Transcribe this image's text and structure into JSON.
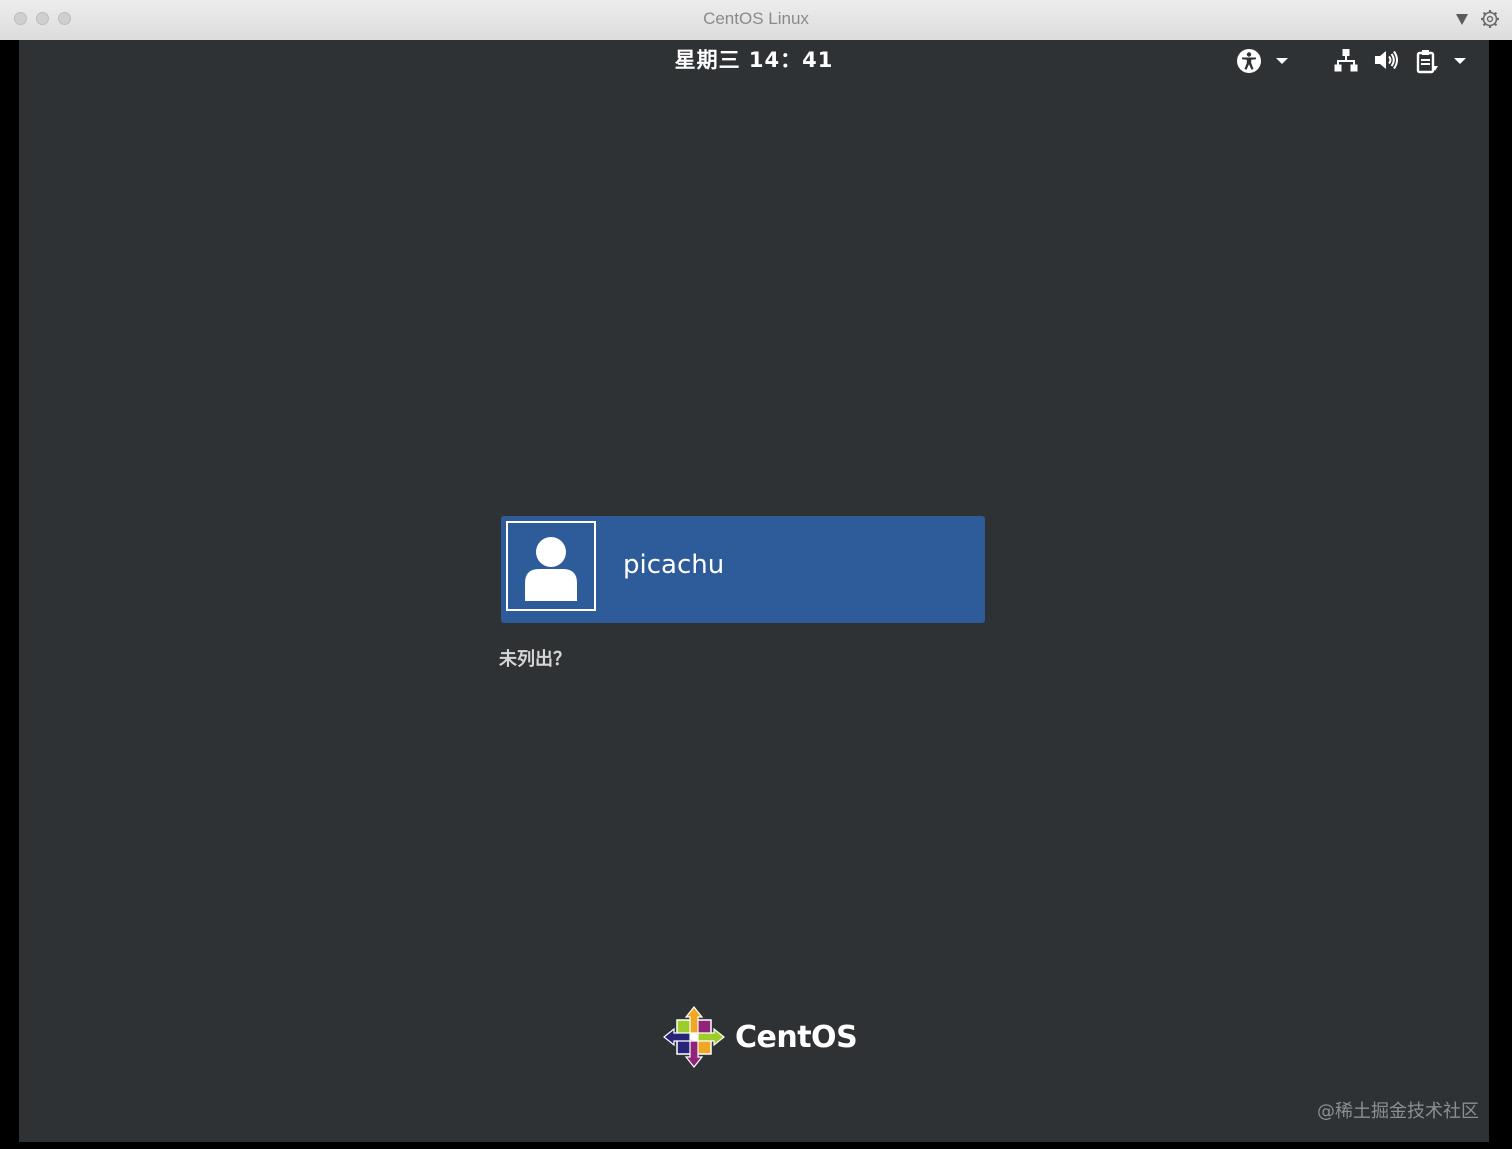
{
  "window": {
    "title": "CentOS Linux",
    "icons": [
      "traffic-close",
      "traffic-minimize",
      "traffic-zoom",
      "dropdown-arrow-icon",
      "gear-icon"
    ]
  },
  "top_panel": {
    "clock": "星期三 14：41",
    "icons": [
      "accessibility-icon",
      "network-icon",
      "volume-icon",
      "power-icon"
    ]
  },
  "login": {
    "user_name": "picachu",
    "not_listed": "未列出？"
  },
  "branding": {
    "logo_text": "CentOS"
  },
  "watermark": "@稀土掘金技术社区",
  "colors": {
    "desktop_bg": "#2f3234",
    "user_entry_bg": "#2e5b9a"
  }
}
